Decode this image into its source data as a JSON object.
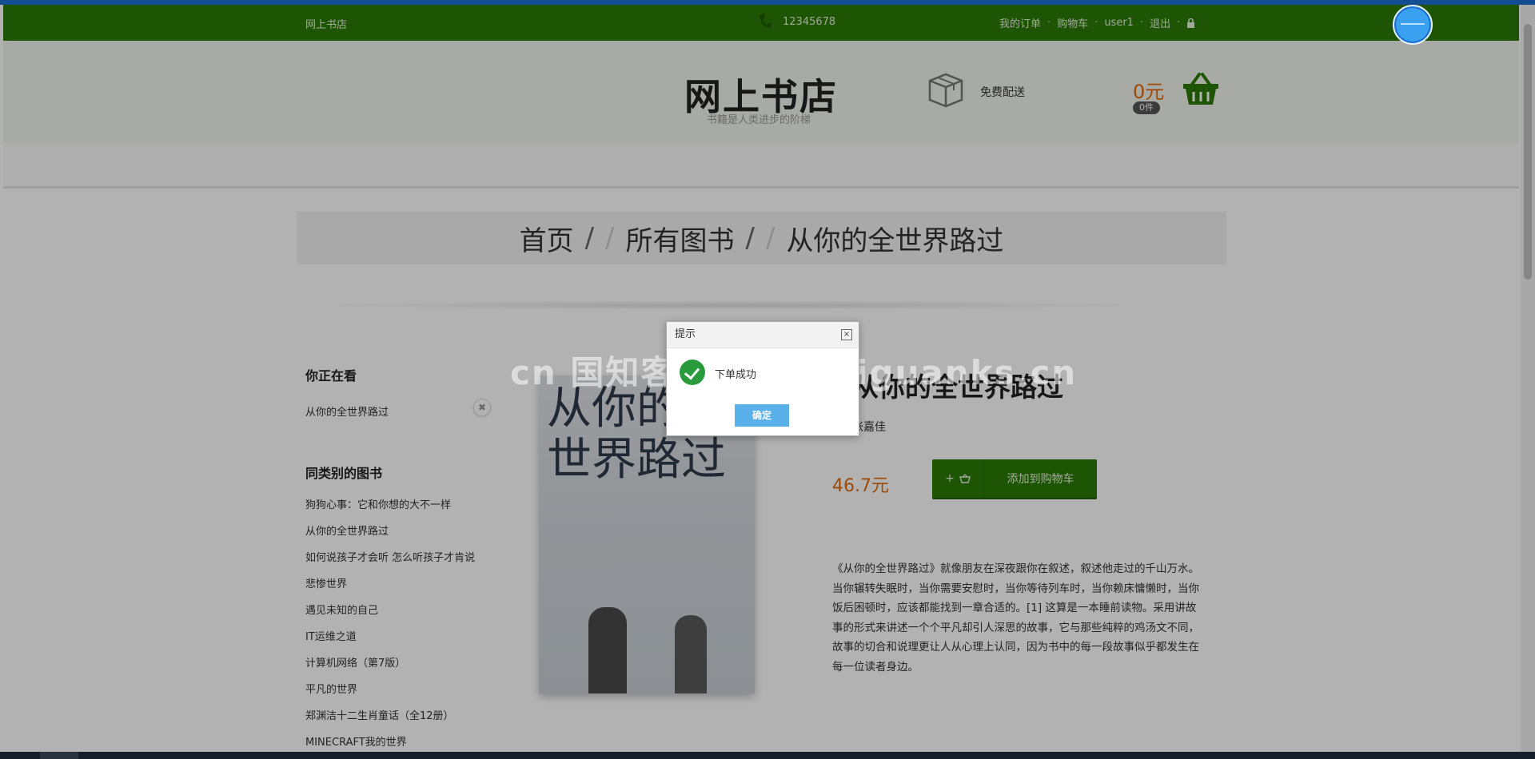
{
  "topbar": {
    "brand": "网上书店",
    "phone": "12345678",
    "links": [
      {
        "label": "我的订单"
      },
      {
        "label": "购物车"
      },
      {
        "label": "user1"
      },
      {
        "label": "退出"
      }
    ],
    "separator": "·"
  },
  "header": {
    "title": "网上书店",
    "subtitle": "书籍是人类进步的阶梯",
    "free_shipping": "免费配送",
    "cart_total": "0元",
    "cart_count": "0件"
  },
  "breadcrumb": {
    "items": [
      "首页",
      "所有图书",
      "从你的全世界路过"
    ],
    "separator": "/"
  },
  "sidebar": {
    "viewing_title": "你正在看",
    "viewing_item": "从你的全世界路过",
    "category_title": "同类别的图书",
    "category_items": [
      "狗狗心事：它和你想的大不一样",
      "从你的全世界路过",
      "如何说孩子才会听 怎么听孩子才肯说",
      "悲惨世界",
      "遇见未知的自己",
      "IT运维之道",
      "计算机网络（第7版）",
      "平凡的世界",
      "郑渊洁十二生肖童话（全12册）",
      "MINECRAFT我的世界"
    ]
  },
  "product": {
    "cover_text": "从你的全世界路过",
    "title": "从你的全世界路过",
    "author": "张嘉佳",
    "price": "46.7元",
    "add_to_cart": "添加到购物车",
    "add_icon_text": "+",
    "description": "《从你的全世界路过》就像朋友在深夜跟你在叙述，叙述他走过的千山万水。当你辗转失眠时，当你需要安慰时，当你等待列车时，当你赖床慵懒时，当你饭后困顿时，应该都能找到一章合适的。[1] 这算是一本睡前读物。采用讲故事的形式来讲述一个个平凡却引人深思的故事，它与那些纯粹的鸡汤文不同，故事的切合和说理更让人从心理上认同，因为书中的每一段故事似乎都发生在每一位读者身边。"
  },
  "dialog": {
    "title": "提示",
    "message": "下单成功",
    "confirm": "确定",
    "close": "×"
  },
  "watermark": "cn 国知客 www.weiguanks.cn",
  "colors": {
    "brand_green": "#2c7a06",
    "price_orange": "#e36b0a",
    "button_blue": "#5ab0e8"
  },
  "icons": [
    "phone-icon",
    "lock-icon",
    "box-icon",
    "basket-icon",
    "remove-icon",
    "success-icon",
    "close-icon"
  ]
}
